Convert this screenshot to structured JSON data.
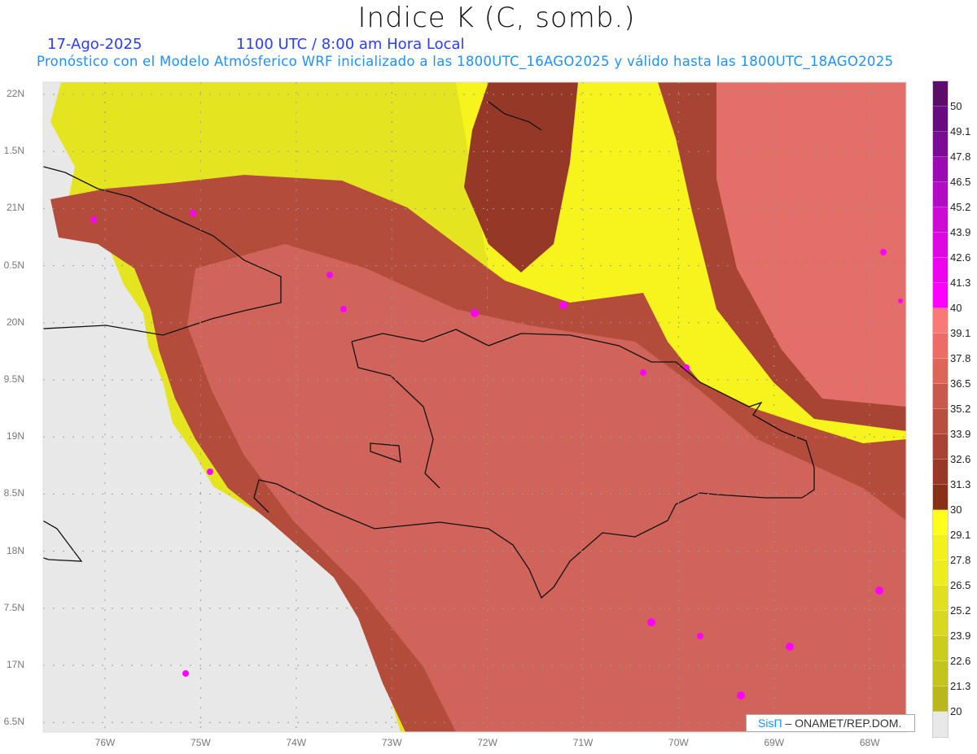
{
  "header": {
    "title": "Indice K (C, somb.)",
    "date": "17-Ago-2025",
    "time": "1100 UTC / 8:00 am Hora Local",
    "subtitle": "Pronóstico con el Modelo Atmósferico WRF inicializado a las 1800UTC_16AGO2025 y válido hasta las  1800UTC_18AGO2025"
  },
  "axes": {
    "lat_labels": [
      "22N",
      "1.5N",
      "21N",
      "0.5N",
      "20N",
      "9.5N",
      "19N",
      "8.5N",
      "18N",
      "7.5N",
      "17N",
      "6.5N"
    ],
    "lon_labels": [
      "76W",
      "75W",
      "74W",
      "73W",
      "72W",
      "71W",
      "70W",
      "69W",
      "68W"
    ]
  },
  "colorbar": {
    "labels": [
      "50",
      "49.1",
      "47.8",
      "46.5",
      "45.2",
      "43.9",
      "42.6",
      "41.3",
      "40",
      "39.1",
      "37.8",
      "36.5",
      "35.2",
      "33.9",
      "32.6",
      "31.3",
      "30",
      "29.1",
      "27.8",
      "26.5",
      "25.2",
      "23.9",
      "22.6",
      "21.3",
      "20"
    ],
    "colors": [
      "#5c0c6c",
      "#6a0a80",
      "#7c0c94",
      "#9a0cb0",
      "#b00cc4",
      "#cc0cd4",
      "#dc08e0",
      "#ec04ec",
      "#ff00ff",
      "#f87a78",
      "#ec6c68",
      "#dc6658",
      "#c85a4c",
      "#b85040",
      "#a84434",
      "#983828",
      "#8a3018",
      "#ffff1a",
      "#f4f01a",
      "#ecec1e",
      "#e0e020",
      "#d8d820",
      "#cccc1c",
      "#c4c41c",
      "#b8b81c",
      "#e8e8e8"
    ]
  },
  "credit": {
    "brand": "SisΠ",
    "org": "– ONAMET/REP.DOM."
  }
}
